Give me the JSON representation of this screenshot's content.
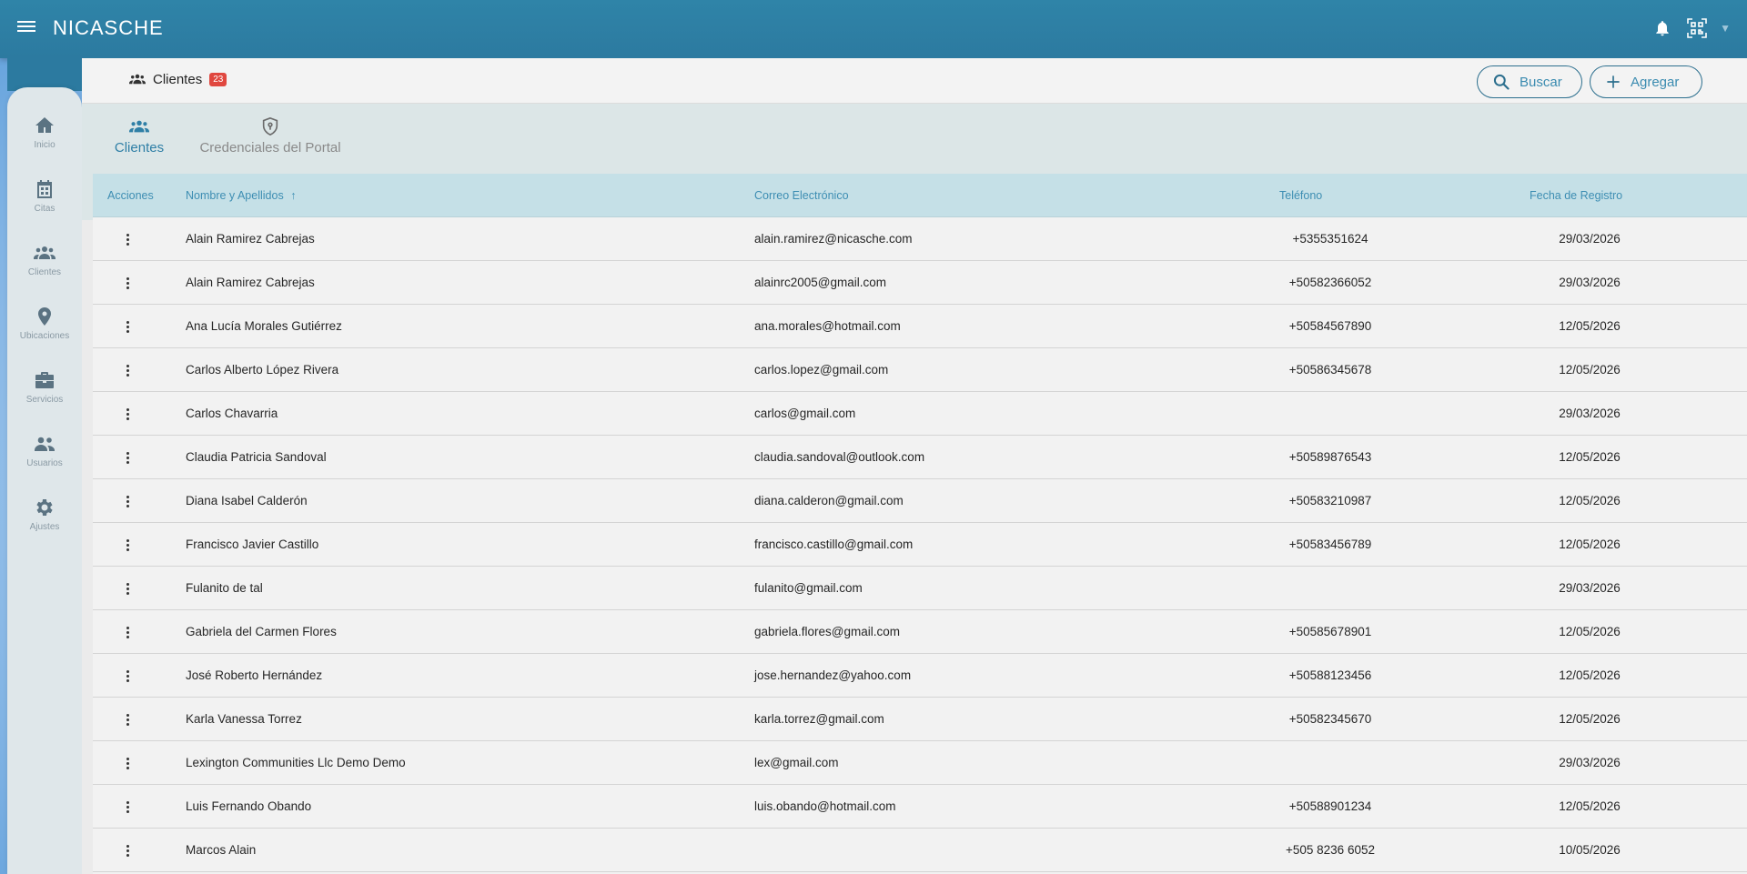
{
  "app": {
    "brand": "NICASCHE"
  },
  "sidebar": {
    "items": [
      {
        "label": "Inicio",
        "icon": "home-icon"
      },
      {
        "label": "Citas",
        "icon": "calendar-icon"
      },
      {
        "label": "Clientes",
        "icon": "people-icon"
      },
      {
        "label": "Ubicaciones",
        "icon": "location-pin-icon"
      },
      {
        "label": "Servicios",
        "icon": "briefcase-icon"
      },
      {
        "label": "Usuarios",
        "icon": "users-icon"
      },
      {
        "label": "Ajustes",
        "icon": "gear-icon"
      }
    ]
  },
  "header": {
    "title": "Clientes",
    "count": "23",
    "search_label": "Buscar",
    "add_label": "Agregar"
  },
  "tabs": [
    {
      "label": "Clientes",
      "icon": "people-icon"
    },
    {
      "label": "Credenciales del Portal",
      "icon": "shield-key-icon"
    }
  ],
  "table": {
    "headers": {
      "actions": "Acciones",
      "name": "Nombre y Apellidos",
      "email": "Correo Electrónico",
      "phone": "Teléfono",
      "date": "Fecha de Registro"
    },
    "rows": [
      {
        "name": "Alain Ramirez Cabrejas",
        "email": "alain.ramirez@nicasche.com",
        "phone": "+5355351624",
        "date": "29/03/2026"
      },
      {
        "name": "Alain Ramirez Cabrejas",
        "email": "alainrc2005@gmail.com",
        "phone": "+50582366052",
        "date": "29/03/2026"
      },
      {
        "name": "Ana Lucía Morales Gutiérrez",
        "email": "ana.morales@hotmail.com",
        "phone": "+50584567890",
        "date": "12/05/2026"
      },
      {
        "name": "Carlos Alberto López Rivera",
        "email": "carlos.lopez@gmail.com",
        "phone": "+50586345678",
        "date": "12/05/2026"
      },
      {
        "name": "Carlos Chavarria",
        "email": "carlos@gmail.com",
        "phone": "",
        "date": "29/03/2026"
      },
      {
        "name": "Claudia Patricia Sandoval",
        "email": "claudia.sandoval@outlook.com",
        "phone": "+50589876543",
        "date": "12/05/2026"
      },
      {
        "name": "Diana Isabel Calderón",
        "email": "diana.calderon@gmail.com",
        "phone": "+50583210987",
        "date": "12/05/2026"
      },
      {
        "name": "Francisco Javier Castillo",
        "email": "francisco.castillo@gmail.com",
        "phone": "+50583456789",
        "date": "12/05/2026"
      },
      {
        "name": "Fulanito de tal",
        "email": "fulanito@gmail.com",
        "phone": "",
        "date": "29/03/2026"
      },
      {
        "name": "Gabriela del Carmen Flores",
        "email": "gabriela.flores@gmail.com",
        "phone": "+50585678901",
        "date": "12/05/2026"
      },
      {
        "name": "José Roberto Hernández",
        "email": "jose.hernandez@yahoo.com",
        "phone": "+50588123456",
        "date": "12/05/2026"
      },
      {
        "name": "Karla Vanessa Torrez",
        "email": "karla.torrez@gmail.com",
        "phone": "+50582345670",
        "date": "12/05/2026"
      },
      {
        "name": "Lexington Communities Llc Demo Demo",
        "email": "lex@gmail.com",
        "phone": "",
        "date": "29/03/2026"
      },
      {
        "name": "Luis Fernando Obando",
        "email": "luis.obando@hotmail.com",
        "phone": "+50588901234",
        "date": "12/05/2026"
      },
      {
        "name": "Marcos Alain",
        "email": "",
        "phone": "+505 8236 6052",
        "date": "10/05/2026"
      }
    ]
  },
  "colors": {
    "topbar": "#2c7aa0",
    "accent": "#3a8bb0",
    "badge": "#e0473f"
  }
}
